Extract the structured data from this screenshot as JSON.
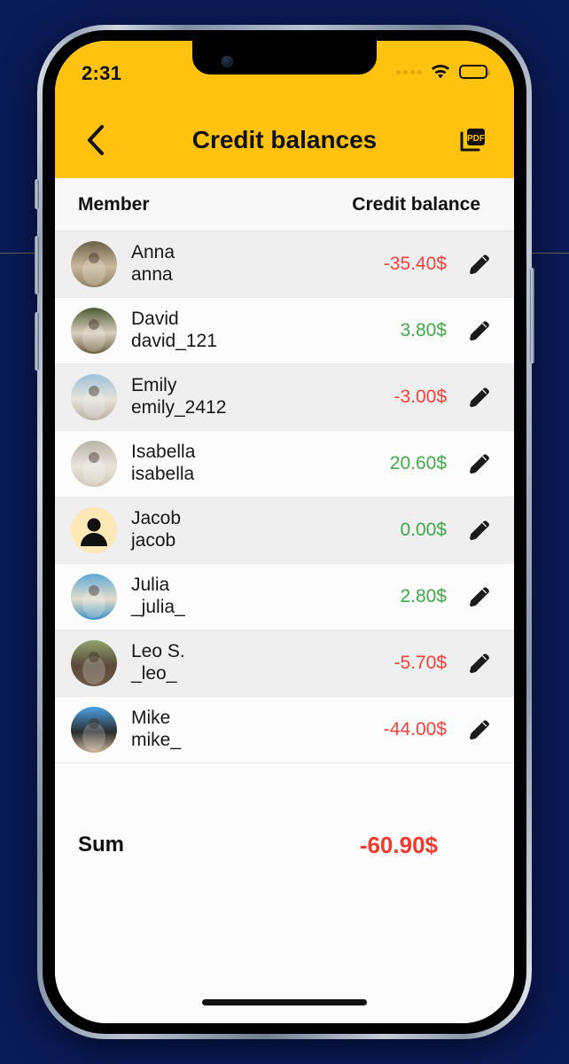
{
  "theme": {
    "accent": "#FFC20E",
    "negative": "#F4433C",
    "positive": "#42A84A",
    "sum_negative": "#F03B2D",
    "background": "#0a1a56",
    "row_alt": "#efefef",
    "row_base": "#fcfcfc"
  },
  "status_bar": {
    "time": "2:31",
    "signal_icon": "signal-dots-icon",
    "wifi_icon": "wifi-icon",
    "battery_icon": "battery-full-icon"
  },
  "navbar": {
    "back_icon": "chevron-left-icon",
    "title": "Credit balances",
    "pdf_icon": "pdf-export-icon",
    "pdf_label": "PDF"
  },
  "table": {
    "columns": {
      "member": "Member",
      "balance": "Credit balance"
    },
    "edit_icon": "pencil-edit-icon",
    "rows": [
      {
        "name": "Anna",
        "handle": "anna",
        "amount": "-35.40$",
        "sign": "neg",
        "avatar": "photo"
      },
      {
        "name": "David",
        "handle": "david_121",
        "amount": "3.80$",
        "sign": "pos",
        "avatar": "photo"
      },
      {
        "name": "Emily",
        "handle": "emily_2412",
        "amount": "-3.00$",
        "sign": "neg",
        "avatar": "photo"
      },
      {
        "name": "Isabella",
        "handle": "isabella",
        "amount": "20.60$",
        "sign": "pos",
        "avatar": "photo"
      },
      {
        "name": "Jacob",
        "handle": "jacob",
        "amount": "0.00$",
        "sign": "pos",
        "avatar": "placeholder"
      },
      {
        "name": "Julia",
        "handle": "_julia_",
        "amount": "2.80$",
        "sign": "pos",
        "avatar": "photo"
      },
      {
        "name": "Leo S.",
        "handle": "_leo_",
        "amount": "-5.70$",
        "sign": "neg",
        "avatar": "photo"
      },
      {
        "name": "Mike",
        "handle": "mike_",
        "amount": "-44.00$",
        "sign": "neg",
        "avatar": "photo"
      }
    ]
  },
  "summary": {
    "label": "Sum",
    "value": "-60.90$",
    "sign": "neg"
  }
}
